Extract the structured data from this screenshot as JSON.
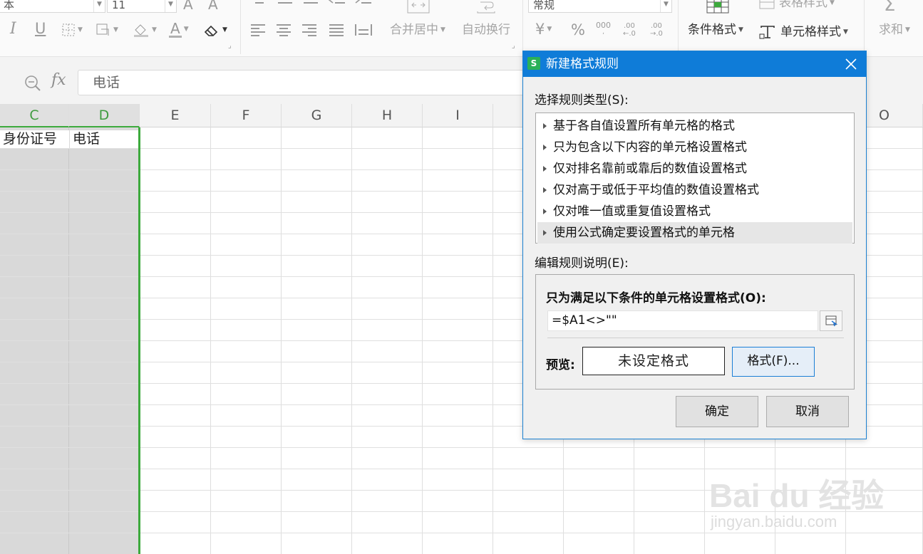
{
  "ribbon": {
    "font_name": "本",
    "font_size": "11",
    "number_format": "常规",
    "merge_center": "合并居中",
    "auto_wrap": "自动换行",
    "conditional_format": "条件格式",
    "table_style": "表格样式",
    "cell_style": "单元格样式",
    "sum": "求和",
    "decimal_inc_top": ".00",
    "decimal_inc_bot": "←.0",
    "decimal_dec_top": ".00",
    "decimal_dec_bot": "→.0",
    "thousands": "000"
  },
  "formula_bar": {
    "fx_label": "fx",
    "value": "电话"
  },
  "sheet": {
    "columns": [
      "C",
      "D",
      "E",
      "F",
      "G",
      "H",
      "I",
      "O"
    ],
    "cells": {
      "C1": "身份证号",
      "D1": "电话"
    }
  },
  "dialog": {
    "title": "新建格式规则",
    "logo": "S",
    "rule_type_label": "选择规则类型(S):",
    "rule_types": [
      "基于各自值设置所有单元格的格式",
      "只为包含以下内容的单元格设置格式",
      "仅对排名靠前或靠后的数值设置格式",
      "仅对高于或低于平均值的数值设置格式",
      "仅对唯一值或重复值设置格式",
      "使用公式确定要设置格式的单元格"
    ],
    "edit_label": "编辑规则说明(E):",
    "condition_title": "只为满足以下条件的单元格设置格式(O):",
    "formula": "=$A1<>\"\"",
    "preview_label": "预览:",
    "preview_text": "未设定格式",
    "format_button": "格式(F)...",
    "ok_button": "确定",
    "cancel_button": "取消"
  },
  "watermark": {
    "logo": "Bai du 经验",
    "url": "jingyan.baidu.com"
  }
}
